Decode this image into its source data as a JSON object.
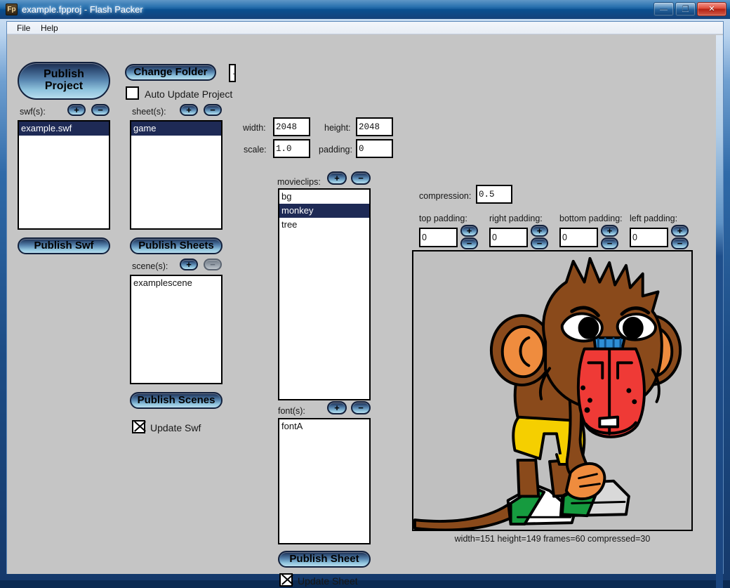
{
  "window": {
    "title": "example.fpproj - Flash Packer",
    "app_icon": "Fp",
    "controls": {
      "minimize": "minimize-icon",
      "maximize": "maximize-icon",
      "close": "close-icon",
      "minimize_glyph": "—",
      "maximize_glyph": "❐",
      "close_glyph": "✕"
    }
  },
  "menu": {
    "file": "File",
    "help": "Help"
  },
  "colors": {
    "panel_bg": "#c5c5c5",
    "button_dark": "#1c2c4d",
    "button_light": "#b7dced",
    "list_selection": "#1e2a55",
    "title_bar": "#0a5fa8",
    "close_button": "#b32113"
  },
  "toolbar": {
    "publish_project_line1": "Publish",
    "publish_project_line2": "Project",
    "change_folder_label": "Change Folder",
    "folder_path_value": ".",
    "auto_update_project_label": "Auto Update Project",
    "auto_update_project_checked": false
  },
  "swf_section": {
    "label": "swf(s):",
    "add_label": "+",
    "remove_label": "−",
    "items": [
      {
        "label": "example.swf",
        "selected": true
      }
    ],
    "publish_button": "Publish Swf",
    "update_label": "Update Swf",
    "update_checked": true
  },
  "sheet_section": {
    "label": "sheet(s):",
    "add_label": "+",
    "remove_label": "−",
    "items": [
      {
        "label": "game",
        "selected": true
      }
    ],
    "publish_button": "Publish Sheets"
  },
  "scene_section": {
    "label": "scene(s):",
    "add_label": "+",
    "remove_label": "−",
    "remove_disabled": true,
    "items": [
      {
        "label": "examplescene",
        "selected": false
      }
    ],
    "publish_button": "Publish Scenes"
  },
  "sheet_settings": {
    "width_label": "width:",
    "width_value": "2048",
    "height_label": "height:",
    "height_value": "2048",
    "scale_label": "scale:",
    "scale_value": "1.0",
    "padding_label": "padding:",
    "padding_value": "0"
  },
  "movieclips_section": {
    "label": "movieclips:",
    "add_label": "+",
    "remove_label": "−",
    "items": [
      {
        "label": "bg",
        "selected": false
      },
      {
        "label": "monkey",
        "selected": true
      },
      {
        "label": "tree",
        "selected": false
      }
    ]
  },
  "fonts_section": {
    "label": "font(s):",
    "add_label": "+",
    "remove_label": "−",
    "items": [
      {
        "label": "fontA",
        "selected": false
      }
    ],
    "publish_button": "Publish Sheet",
    "update_label": "Update Sheet",
    "update_checked": true
  },
  "clip_settings": {
    "compression_label": "compression:",
    "compression_value": "0.5",
    "paddings": [
      {
        "label": "top padding:",
        "value": "0",
        "plus": "+",
        "minus": "−"
      },
      {
        "label": "right padding:",
        "value": "0",
        "plus": "+",
        "minus": "−"
      },
      {
        "label": "bottom padding:",
        "value": "0",
        "plus": "+",
        "minus": "−"
      },
      {
        "label": "left padding:",
        "value": "0",
        "plus": "+",
        "minus": "−"
      }
    ]
  },
  "preview": {
    "image_name": "monkey-character-preview",
    "caption": "width=151 height=149 frames=60 compressed=30"
  }
}
